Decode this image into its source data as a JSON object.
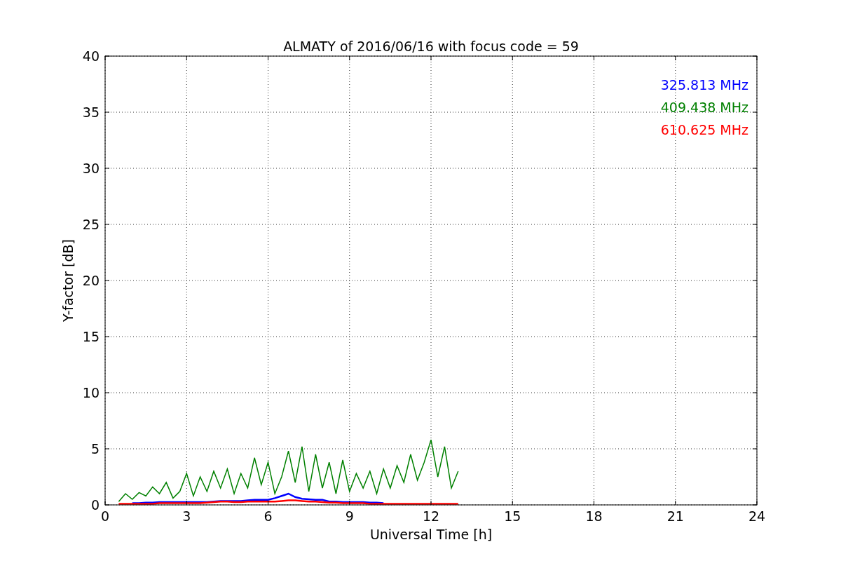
{
  "chart_data": {
    "type": "line",
    "title": "ALMATY of 2016/06/16 with focus code = 59",
    "xlabel": "Universal Time [h]",
    "ylabel": "Y-factor [dB]",
    "x": [
      0.5,
      0.75,
      1,
      1.25,
      1.5,
      1.75,
      2,
      2.25,
      2.5,
      2.75,
      3,
      3.25,
      3.5,
      3.75,
      4,
      4.25,
      4.5,
      4.75,
      5,
      5.25,
      5.5,
      5.75,
      6,
      6.25,
      6.5,
      6.75,
      7,
      7.25,
      7.5,
      7.75,
      8,
      8.25,
      8.5,
      8.75,
      9,
      9.25,
      9.5,
      9.75,
      10,
      10.25,
      10.5,
      10.75,
      11,
      11.25,
      11.5,
      11.75,
      12,
      12.25,
      12.5,
      12.75,
      13
    ],
    "series": [
      {
        "name": "325.813 MHz",
        "color": "#0000ff",
        "values": [
          null,
          null,
          0.15,
          0.15,
          0.2,
          0.2,
          0.25,
          0.25,
          0.25,
          0.25,
          0.25,
          0.25,
          0.25,
          0.25,
          0.3,
          0.35,
          0.35,
          0.35,
          0.35,
          0.4,
          0.45,
          0.45,
          0.45,
          0.6,
          0.8,
          1.0,
          0.7,
          0.55,
          0.5,
          0.45,
          0.45,
          0.3,
          0.3,
          0.25,
          0.25,
          0.25,
          0.25,
          0.2,
          0.2,
          0.15,
          null,
          null,
          null,
          null,
          null,
          null,
          null,
          null,
          null,
          null,
          null
        ]
      },
      {
        "name": "409.438 MHz",
        "color": "#008000",
        "values": [
          0.3,
          1.0,
          0.5,
          1.1,
          0.8,
          1.6,
          1.0,
          2.0,
          0.6,
          1.2,
          2.8,
          0.8,
          2.5,
          1.2,
          3.0,
          1.5,
          3.2,
          1.0,
          2.8,
          1.5,
          4.2,
          1.8,
          3.8,
          1.0,
          2.5,
          4.8,
          2.0,
          5.2,
          1.2,
          4.5,
          1.5,
          3.8,
          1.0,
          4.0,
          1.2,
          2.8,
          1.5,
          3.0,
          1.0,
          3.2,
          1.5,
          3.5,
          2.0,
          4.5,
          2.2,
          3.8,
          5.8,
          2.5,
          5.2,
          1.5,
          3.0
        ]
      },
      {
        "name": "610.625 MHz",
        "color": "#ff0000",
        "values": [
          0.1,
          0.1,
          0.1,
          0.1,
          0.1,
          0.1,
          0.15,
          0.15,
          0.15,
          0.15,
          0.15,
          0.15,
          0.15,
          0.2,
          0.25,
          0.3,
          0.3,
          0.25,
          0.25,
          0.3,
          0.3,
          0.3,
          0.3,
          0.3,
          0.35,
          0.4,
          0.4,
          0.35,
          0.3,
          0.3,
          0.25,
          0.2,
          0.2,
          0.15,
          0.15,
          0.15,
          0.15,
          0.1,
          0.1,
          0.1,
          0.1,
          0.1,
          0.1,
          0.1,
          0.1,
          0.1,
          0.1,
          0.1,
          0.1,
          0.1,
          0.1
        ]
      }
    ],
    "xlim": [
      0,
      24
    ],
    "ylim": [
      0,
      40
    ],
    "grid": true,
    "xticks": [
      0,
      3,
      6,
      9,
      12,
      15,
      18,
      21,
      24
    ],
    "yticks": [
      0,
      5,
      10,
      15,
      20,
      25,
      30,
      35,
      40
    ]
  }
}
